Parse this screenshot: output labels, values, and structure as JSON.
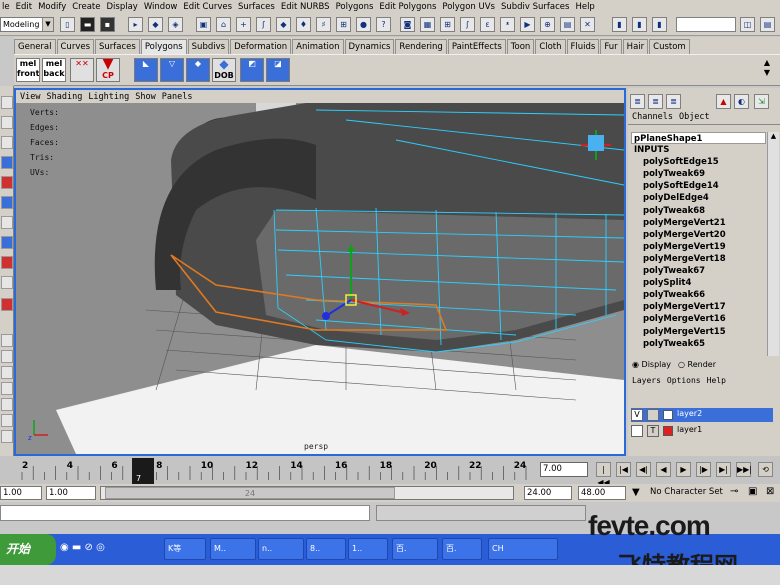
{
  "menubar": [
    "le",
    "Edit",
    "Modify",
    "Create",
    "Display",
    "Window",
    "Edit Curves",
    "Surfaces",
    "Edit NURBS",
    "Polygons",
    "Edit Polygons",
    "Polygon UVs",
    "Subdiv Surfaces",
    "Help"
  ],
  "status": {
    "mode": "Modeling"
  },
  "shelf_tabs": [
    "General",
    "Curves",
    "Surfaces",
    "Polygons",
    "Subdivs",
    "Deformation",
    "Animation",
    "Dynamics",
    "Rendering",
    "PaintEffects",
    "Toon",
    "Cloth",
    "Fluids",
    "Fur",
    "Hair",
    "Custom"
  ],
  "shelf_buttons": {
    "mel1_top": "mel",
    "mel1_bottom": "front",
    "mel2_top": "mel",
    "mel2_bottom": "back",
    "cp": "CP",
    "dob": "DOB"
  },
  "viewport": {
    "menu": [
      "View",
      "Shading",
      "Lighting",
      "Show",
      "Panels"
    ],
    "hud": [
      "Verts:",
      "Edges:",
      "Faces:",
      "Tris:",
      "UVs:"
    ],
    "camera": "persp"
  },
  "channel_box": {
    "menu": [
      "Channels",
      "Object"
    ],
    "selected": "pPlaneShape1",
    "inputs_label": "INPUTS",
    "items": [
      "polySoftEdge15",
      "polyTweak69",
      "polySoftEdge14",
      "polyDelEdge4",
      "polyTweak68",
      "polyMergeVert21",
      "polyMergeVert20",
      "polyMergeVert19",
      "polyMergeVert18",
      "polyTweak67",
      "polySplit4",
      "polyTweak66",
      "polyMergeVert17",
      "polyMergeVert16",
      "polyMergeVert15",
      "polyTweak65"
    ]
  },
  "layer_editor": {
    "display_label": "Display",
    "render_label": "Render",
    "menu": [
      "Layers",
      "Options",
      "Help"
    ],
    "layers": [
      {
        "v": "V",
        "t": "",
        "name": "layer2",
        "color": "#ffffff"
      },
      {
        "v": "",
        "t": "T",
        "name": "layer1",
        "color": "#e02020"
      }
    ]
  },
  "timeline": {
    "ticks": [
      "2",
      "4",
      "6",
      "8",
      "10",
      "12",
      "14",
      "16",
      "18",
      "20",
      "22",
      "24"
    ],
    "current": "7",
    "current_frame": "7.00"
  },
  "range": {
    "start": "1.00",
    "min": "1.00",
    "slider_label": "24",
    "end": "24.00",
    "max": "48.00",
    "character_set": "No Character Set"
  },
  "taskbar": {
    "start": "开始",
    "tasks": [
      "K等",
      "M..",
      "n..",
      "8..",
      "1..",
      "百.",
      "百.",
      "CH"
    ]
  },
  "watermark": {
    "line1": "fevte.com",
    "line2": "飞特教程网"
  }
}
